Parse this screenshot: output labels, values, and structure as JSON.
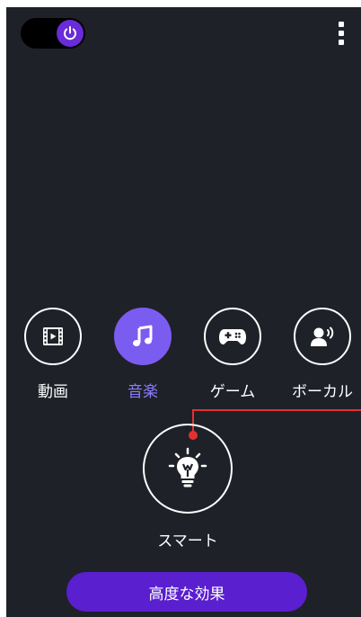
{
  "header": {
    "power_toggle_state": "on",
    "power_icon": "power-icon",
    "menu_icon": "more-vertical-icon"
  },
  "modes": [
    {
      "label": "動画",
      "icon": "film-icon",
      "selected": false
    },
    {
      "label": "音楽",
      "icon": "music-note-icon",
      "selected": true
    },
    {
      "label": "ゲーム",
      "icon": "gamepad-icon",
      "selected": false
    },
    {
      "label": "ボーカル",
      "icon": "voice-icon",
      "selected": false
    }
  ],
  "smart_mode": {
    "label": "スマート",
    "icon": "lightbulb-icon"
  },
  "footer": {
    "advanced_button_label": "高度な効果"
  },
  "colors": {
    "background": "#1e2128",
    "accent": "#7b5cf0",
    "accent_dark": "#5a1fcf",
    "accent_label": "#8f7cff",
    "callout_line": "#e53030"
  }
}
